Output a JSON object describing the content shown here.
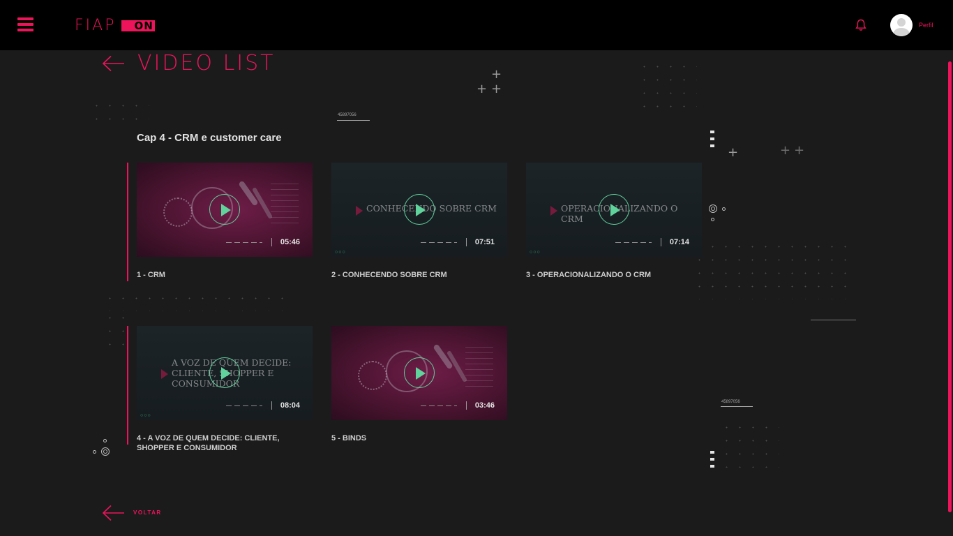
{
  "header": {
    "logo_text": "FIAP",
    "logo_badge": "ON",
    "profile_label": "Perfil",
    "menu_icon": "hamburger-menu-icon",
    "bell_icon": "bell-icon",
    "avatar_icon": "user-avatar-icon"
  },
  "page": {
    "title": "VIDEO LIST",
    "chapter": "Cap 4 - CRM e customer care",
    "back_label": "VOLTAR"
  },
  "decor": {
    "code_tag_1": "45897056",
    "code_tag_2": "45897056"
  },
  "videos": [
    {
      "title": "1 - CRM",
      "duration": "05:46",
      "overlay": ""
    },
    {
      "title": "2 - CONHECENDO SOBRE CRM",
      "duration": "07:51",
      "overlay": "CONHECENDO SOBRE CRM"
    },
    {
      "title": "3 - OPERACIONALIZANDO O CRM",
      "duration": "07:14",
      "overlay": "OPERACIONALIZANDO O CRM"
    },
    {
      "title": "4 - A VOZ DE QUEM DECIDE: CLIENTE, SHOPPER E CONSUMIDOR",
      "duration": "08:04",
      "overlay": "A VOZ DE QUEM DECIDE: CLIENTE, SHOPPER E CONSUMIDOR"
    },
    {
      "title": "5 - BINDS",
      "duration": "03:46",
      "overlay": ""
    }
  ],
  "colors": {
    "accent": "#ed145b",
    "play": "#5fd39b",
    "background": "#1b1b1c",
    "header": "#000000"
  }
}
